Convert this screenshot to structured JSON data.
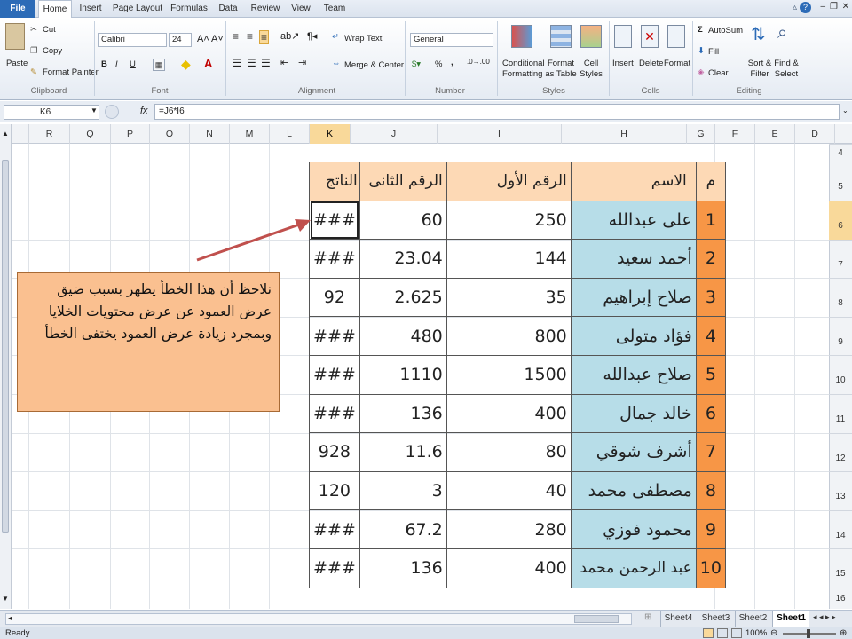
{
  "menu": {
    "tabs": [
      "File",
      "Home",
      "Insert",
      "Page Layout",
      "Formulas",
      "Data",
      "Review",
      "View",
      "Team"
    ]
  },
  "ribbon": {
    "clipboard": {
      "paste": "Paste",
      "cut": "Cut",
      "copy": "Copy",
      "format_painter": "Format Painter",
      "label": "Clipboard"
    },
    "font": {
      "name": "Calibri",
      "size": "24",
      "label": "Font",
      "bold": "B",
      "italic": "I",
      "underline": "U"
    },
    "alignment": {
      "wrap_text": "Wrap Text",
      "merge_center": "Merge & Center",
      "label": "Alignment"
    },
    "number": {
      "format": "General",
      "percent": "%",
      "comma": ",",
      "label": "Number"
    },
    "styles": {
      "conditional_formatting": "Conditional Formatting",
      "format_as_table": "Format as Table",
      "cell_styles": "Cell Styles",
      "label": "Styles"
    },
    "cells": {
      "insert": "Insert",
      "delete": "Delete",
      "format": "Format",
      "label": "Cells"
    },
    "editing": {
      "autosum": "AutoSum",
      "fill": "Fill",
      "clear": "Clear",
      "sort_filter": "Sort & Filter",
      "find_select": "Find & Select",
      "label": "Editing"
    }
  },
  "formula_bar": {
    "name_box": "K6",
    "fx": "fx",
    "formula": "=J6*I6"
  },
  "columns": [
    "R",
    "Q",
    "P",
    "O",
    "N",
    "M",
    "L",
    "K",
    "J",
    "I",
    "H",
    "G",
    "F",
    "E",
    "D"
  ],
  "rows": [
    "4",
    "5",
    "6",
    "7",
    "8",
    "9",
    "10",
    "11",
    "12",
    "13",
    "14",
    "15",
    "16"
  ],
  "table": {
    "headers": {
      "result": "الناتج",
      "second": "الرقم الثانى",
      "first": "الرقم الأول",
      "name": "الاسم",
      "index": "م"
    },
    "rows": [
      {
        "result": "###",
        "second": "60",
        "first": "250",
        "name": "على عبدالله",
        "index": "1"
      },
      {
        "result": "###",
        "second": "23.04",
        "first": "144",
        "name": "أحمد سعيد",
        "index": "2"
      },
      {
        "result": "92",
        "second": "2.625",
        "first": "35",
        "name": "صلاح إبراهيم",
        "index": "3"
      },
      {
        "result": "###",
        "second": "480",
        "first": "800",
        "name": "فؤاد متولى",
        "index": "4"
      },
      {
        "result": "###",
        "second": "1110",
        "first": "1500",
        "name": "صلاح عبدالله",
        "index": "5"
      },
      {
        "result": "###",
        "second": "136",
        "first": "400",
        "name": "خالد جمال",
        "index": "6"
      },
      {
        "result": "928",
        "second": "11.6",
        "first": "80",
        "name": "أشرف شوقي",
        "index": "7"
      },
      {
        "result": "120",
        "second": "3",
        "first": "40",
        "name": "مصطفى محمد",
        "index": "8"
      },
      {
        "result": "###",
        "second": "67.2",
        "first": "280",
        "name": "محمود فوزي",
        "index": "9"
      },
      {
        "result": "###",
        "second": "136",
        "first": "400",
        "name": "عبد الرحمن محمد",
        "index": "10"
      }
    ]
  },
  "note": {
    "line1": "نلاحظ أن هذا الخطأ يظهر بسبب ضيق عرض العمود عن عرض محتويات الخلايا",
    "line2": "وبمجرد زيادة عرض العمود يختفى الخطأ"
  },
  "sheets": [
    "Sheet4",
    "Sheet3",
    "Sheet2",
    "Sheet1"
  ],
  "status": {
    "ready": "Ready",
    "zoom": "100%"
  },
  "colors": {
    "header_fill": "#fdd9b5",
    "name_fill": "#b7dde8",
    "index_fill": "#f79646",
    "note_fill": "#fac090",
    "selection": "#f9d99a",
    "arrow": "#c0504d"
  }
}
